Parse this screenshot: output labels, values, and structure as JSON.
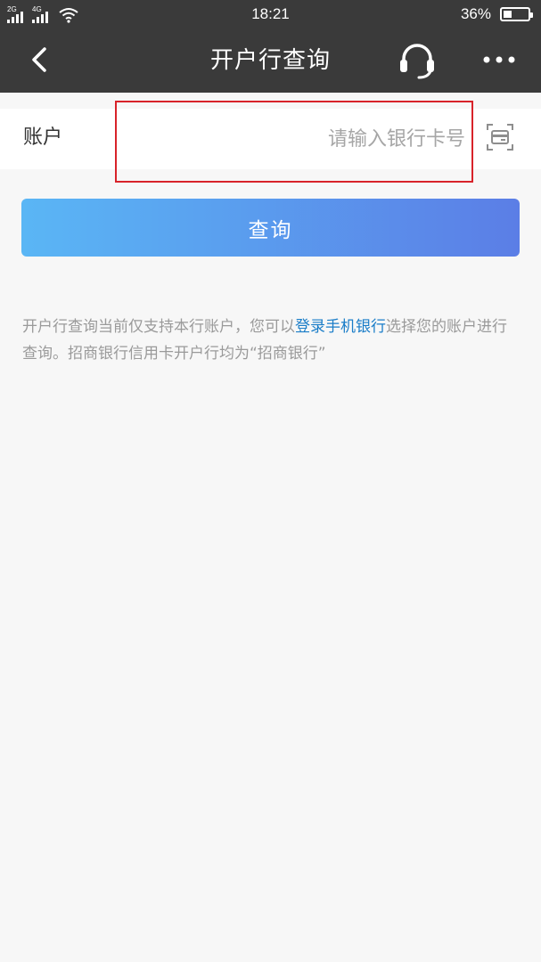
{
  "status_bar": {
    "network_1": "2G",
    "network_2": "4G",
    "time": "18:21",
    "battery_percent": "36%",
    "battery_level": 0.36
  },
  "nav": {
    "title": "开户行查询",
    "back_icon": "chevron-left-icon",
    "service_icon": "headset-icon",
    "more_icon": "more-dots-icon"
  },
  "form": {
    "account_label": "账户",
    "account_placeholder": "请输入银行卡号",
    "account_value": "",
    "scan_icon": "card-scan-icon"
  },
  "query_button_label": "查询",
  "notice": {
    "text_before": "开户行查询当前仅支持本行账户，您可以",
    "link": "登录手机银行",
    "text_after": "选择您的账户进行查询。招商银行信用卡开户行均为“招商银行”"
  },
  "colors": {
    "header_bg": "#3a3a3a",
    "page_bg": "#f7f7f7",
    "button_gradient_start": "#5ab6f5",
    "button_gradient_end": "#5b7ee6",
    "link": "#1a7dc8",
    "highlight": "#d8232a"
  }
}
